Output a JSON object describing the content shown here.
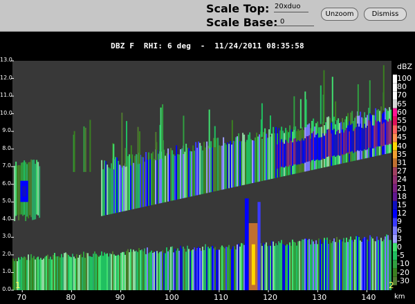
{
  "header": {
    "scale_top_label": "Scale Top:",
    "scale_top_value": "20xduo",
    "scale_base_label": "Scale Base:",
    "scale_base_value": "0",
    "unzoom_label": "Unzoom",
    "dismiss_label": "Dismiss"
  },
  "title": "DBZ F  RHI: 6 deg  -  11/24/2011 08:35:58",
  "marker_left": "1",
  "marker_right": "2",
  "chart_data": {
    "type": "heatmap",
    "title": "DBZ F  RHI: 6 deg  -  11/24/2011 08:35:58",
    "xlabel": "km",
    "ylabel": "",
    "xlim": [
      68,
      145
    ],
    "ylim": [
      0,
      13
    ],
    "x_ticks": [
      "70",
      "80",
      "90",
      "100",
      "110",
      "120",
      "130",
      "140"
    ],
    "x_tick_values": [
      70,
      80,
      90,
      100,
      110,
      120,
      130,
      140
    ],
    "y_ticks": [
      "0.0",
      "1.0",
      "2.0",
      "3.0",
      "4.0",
      "5.0",
      "6.0",
      "7.0",
      "8.0",
      "9.0",
      "10.0",
      "11.0",
      "12.0",
      "13.0"
    ],
    "legend_title": "dBZ",
    "legend": [
      {
        "label": "100",
        "color": "#ffffff"
      },
      {
        "label": "80",
        "color": "#ffffff"
      },
      {
        "label": "70",
        "color": "#ffffff"
      },
      {
        "label": "65",
        "color": "#d8d8d8"
      },
      {
        "label": "60",
        "color": "#ff1493"
      },
      {
        "label": "55",
        "color": "#e0105a"
      },
      {
        "label": "50",
        "color": "#ff6060"
      },
      {
        "label": "45",
        "color": "#ff9050"
      },
      {
        "label": "40",
        "color": "#ffd700"
      },
      {
        "label": "35",
        "color": "#f0a030"
      },
      {
        "label": "31",
        "color": "#c07030"
      },
      {
        "label": "27",
        "color": "#a04060"
      },
      {
        "label": "24",
        "color": "#903070"
      },
      {
        "label": "21",
        "color": "#7a2080"
      },
      {
        "label": "18",
        "color": "#601890"
      },
      {
        "label": "15",
        "color": "#1010c0"
      },
      {
        "label": "12",
        "color": "#0000ff"
      },
      {
        "label": "9",
        "color": "#3a3aff"
      },
      {
        "label": "6",
        "color": "#7a7aff"
      },
      {
        "label": "3",
        "color": "#a0a0ff"
      },
      {
        "label": "0",
        "color": "#40e070"
      },
      {
        "label": "-5",
        "color": "#20c060"
      },
      {
        "label": "-10",
        "color": "#30a040"
      },
      {
        "label": "-20",
        "color": "#3a8020"
      },
      {
        "label": "-30",
        "color": "#507a30"
      }
    ],
    "grid": false
  },
  "colors": {
    "background": "#000000",
    "plot_background": "#383838",
    "toolbar": "#c6c6c6"
  }
}
